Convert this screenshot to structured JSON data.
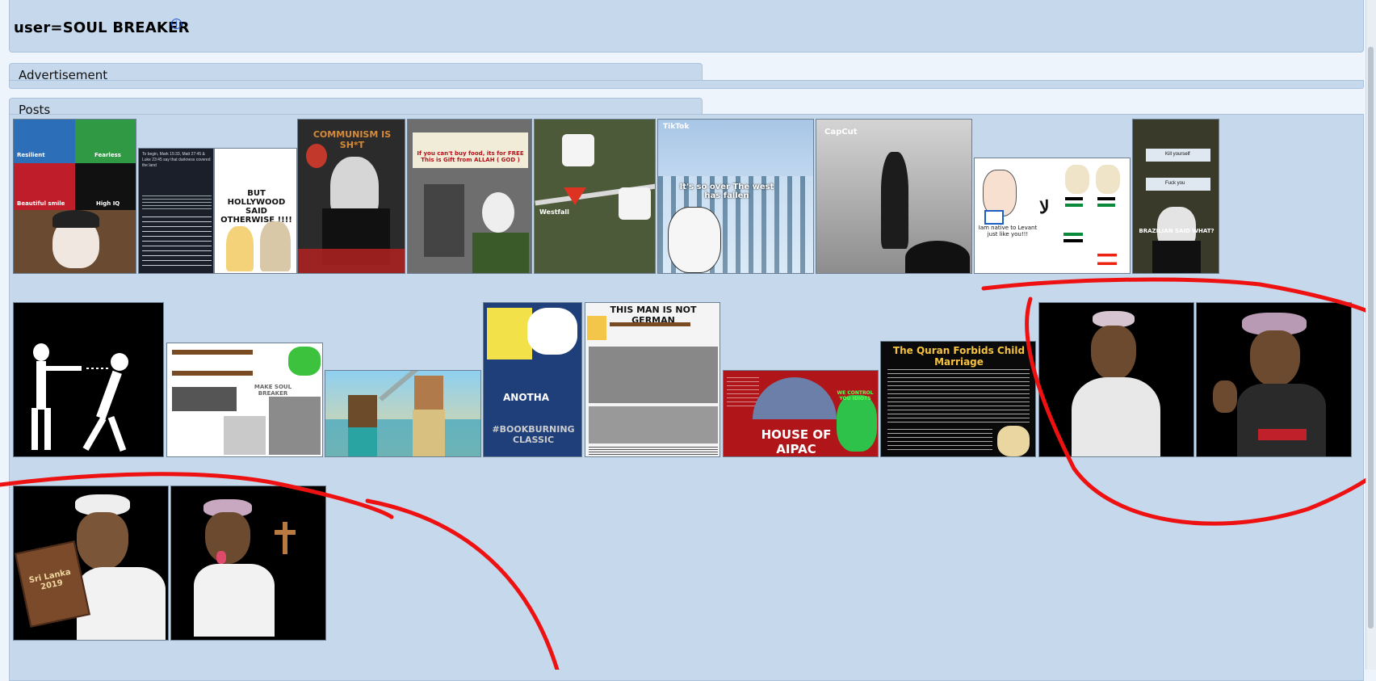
{
  "user_title": "user=SOUL BREAKER",
  "info_icon": "info-icon",
  "sections": {
    "advertisement": "Advertisement",
    "posts": "Posts"
  },
  "posts": {
    "row1": [
      {
        "name": "meme-resilient-fearless",
        "labels": [
          "Resilient",
          "Fearless",
          "Beautiful smile",
          "High IQ"
        ]
      },
      {
        "name": "eclipse-text-post",
        "text": "To begin, Mark 15:33, Matt 27:45 & Luke 23:45 say that darkness covered the land"
      },
      {
        "name": "hollywood-meme",
        "caption": "BUT HOLLYWOOD SAID OTHERWISE !!!!"
      },
      {
        "name": "communism-meme",
        "caption": "COMMUNISM IS SH*T"
      },
      {
        "name": "free-food-meme",
        "caption": "If you can't buy food, its for FREE This is Gift from ALLAH ( GOD )"
      },
      {
        "name": "map-meme",
        "caption": "Westfall"
      },
      {
        "name": "tiktok-west-fallen",
        "caption": "It's so over The west has fallen",
        "badge": "TikTok"
      },
      {
        "name": "capcut-video-still",
        "badge": "CapCut"
      },
      {
        "name": "native-to-levant-meme",
        "caption": "Iam native to Levant just like you!!!"
      },
      {
        "name": "brazilian-said-what",
        "caption": "BRAZILIAN SAID WHAT?",
        "lines": [
          "Kill yourself",
          "Fuck you"
        ]
      }
    ],
    "row2": [
      {
        "name": "stick-figure-meme"
      },
      {
        "name": "soul-breaker-rifle-collage",
        "caption": "MAKE SOUL BREAKER"
      },
      {
        "name": "minecraft-meme"
      },
      {
        "name": "spongebob-bookburning",
        "caption": "#BOOKBURNING CLASSIC",
        "sub": "ANOTHA"
      },
      {
        "name": "not-german-meme",
        "caption": "THIS MAN IS NOT GERMAN"
      },
      {
        "name": "house-of-aipac",
        "caption": "HOUSE OF AIPAC",
        "sub": "WE CONTROL YOU IDIOTS"
      },
      {
        "name": "quran-child-marriage",
        "caption": "The Quran Forbids Child Marriage"
      },
      {
        "name": "cartoon-woman-pose"
      },
      {
        "name": "cartoon-ok-hand"
      }
    ],
    "row3": [
      {
        "name": "sri-lanka-book-cartoon",
        "caption": "Sri Lanka 2019"
      },
      {
        "name": "cross-tongue-cartoon"
      }
    ]
  },
  "colors": {
    "panel": "#c6d8ec",
    "page": "#eef4fb",
    "annotation": "#ee1111"
  }
}
